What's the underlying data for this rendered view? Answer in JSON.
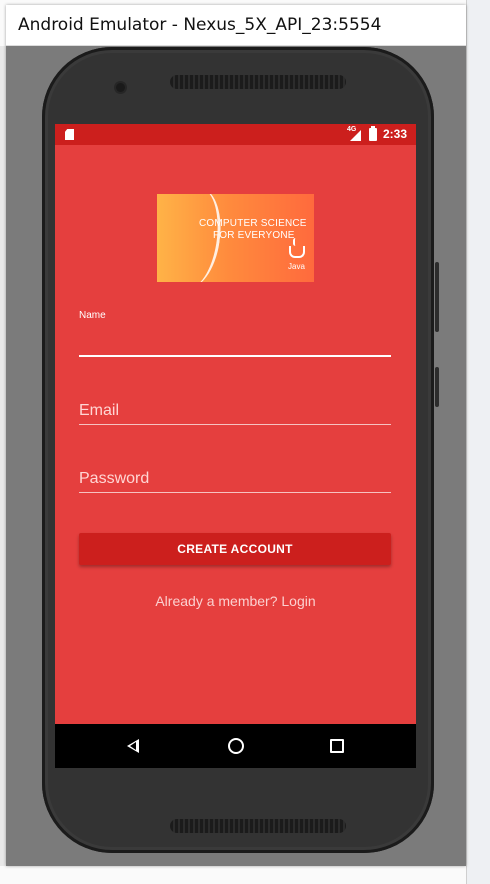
{
  "window": {
    "title": "Android Emulator - Nexus_5X_API_23:5554"
  },
  "status_bar": {
    "network": "4G",
    "time": "2:33",
    "icons": [
      "sd-card-icon",
      "signal-icon",
      "battery-icon"
    ]
  },
  "banner": {
    "line1": "COMPUTER SCIENCE",
    "line2": "FOR EVERYONE",
    "logo_text": "Java"
  },
  "form": {
    "name": {
      "label": "Name",
      "value": ""
    },
    "email": {
      "placeholder": "Email",
      "value": ""
    },
    "password": {
      "placeholder": "Password",
      "value": ""
    },
    "submit_label": "CREATE ACCOUNT",
    "login_link": "Already a member? Login"
  },
  "nav": {
    "icons": [
      "back-icon",
      "home-icon",
      "recents-icon"
    ]
  },
  "colors": {
    "screen_bg": "#e53f3e",
    "status_bar": "#cc1f1d",
    "button": "#cc1f1d",
    "nav_bar": "#000000",
    "emulator_frame": "#7b7b7b"
  }
}
